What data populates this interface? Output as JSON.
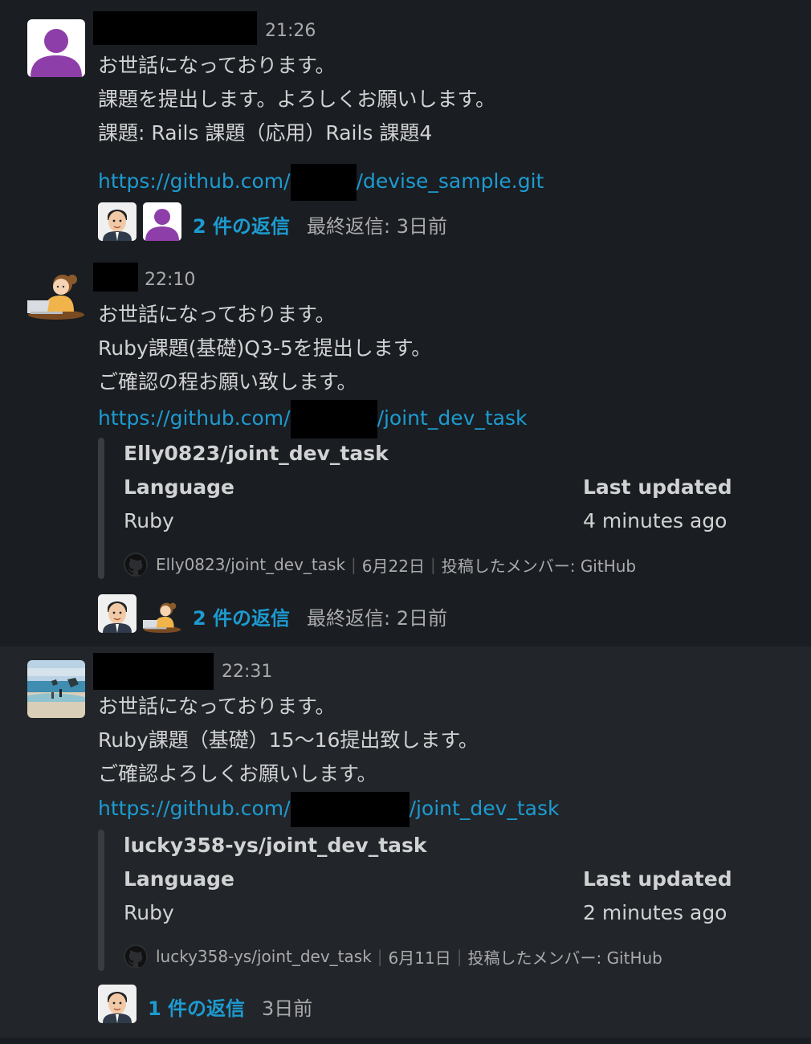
{
  "messages": [
    {
      "time": "21:26",
      "lines": [
        "お世話になっております。",
        "課題を提出します。よろしくお願いします。",
        "課題: Rails 課題（応用）Rails 課題4"
      ],
      "link_prefix": "https://github.com/",
      "link_suffix": "/devise_sample.git",
      "replies_label": "2 件の返信",
      "last_reply": "最終返信: 3日前"
    },
    {
      "time": "22:10",
      "lines": [
        "お世話になっております。",
        "Ruby課題(基礎)Q3-5を提出します。",
        "ご確認の程お願い致します。"
      ],
      "link_prefix": "https://github.com/",
      "link_suffix": "/joint_dev_task",
      "unfurl": {
        "title": "Elly0823/joint_dev_task",
        "language_label": "Language",
        "language_value": "Ruby",
        "updated_label": "Last updated",
        "updated_value": "4 minutes ago",
        "footer_repo": "Elly0823/joint_dev_task",
        "footer_date": "6月22日",
        "footer_poster": "投稿したメンバー: GitHub"
      },
      "replies_label": "2 件の返信",
      "last_reply": "最終返信: 2日前"
    },
    {
      "time": "22:31",
      "lines": [
        "お世話になっております。",
        "Ruby課題（基礎）15〜16提出致します。",
        "ご確認よろしくお願いします。"
      ],
      "link_prefix": "https://github.com/",
      "link_suffix": "/joint_dev_task",
      "unfurl": {
        "title": "lucky358-ys/joint_dev_task",
        "language_label": "Language",
        "language_value": "Ruby",
        "updated_label": "Last updated",
        "updated_value": "2 minutes ago",
        "footer_repo": "lucky358-ys/joint_dev_task",
        "footer_date": "6月11日",
        "footer_poster": "投稿したメンバー: GitHub"
      },
      "replies_label": "1 件の返信",
      "last_reply": "3日前"
    }
  ],
  "colors": {
    "background": "#1a1d21",
    "hover_background": "#222529",
    "link": "#1d9bd1",
    "text": "#d1d2d3",
    "muted": "#ababad"
  },
  "icons": [
    "default-user-avatar",
    "memoji-avatar",
    "laptop-woman-avatar",
    "beach-photo-avatar",
    "github-icon"
  ]
}
